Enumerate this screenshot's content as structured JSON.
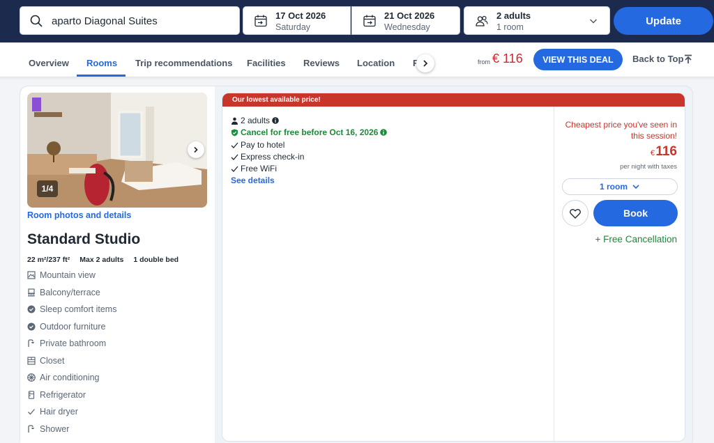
{
  "search": {
    "destination": "aparto Diagonal Suites",
    "checkin_date": "17 Oct 2026",
    "checkin_day": "Saturday",
    "checkout_date": "21 Oct 2026",
    "checkout_day": "Wednesday",
    "guests": "2 adults",
    "rooms": "1 room",
    "update_label": "Update"
  },
  "nav": {
    "tabs": [
      {
        "label": "Overview"
      },
      {
        "label": "Rooms"
      },
      {
        "label": "Trip recommendations"
      },
      {
        "label": "Facilities"
      },
      {
        "label": "Reviews"
      },
      {
        "label": "Location"
      }
    ],
    "truncated_tab": "F",
    "from_label": "from",
    "from_price": "€ 116",
    "deal_label": "VIEW THIS DEAL",
    "back_to_top": "Back to Top"
  },
  "room": {
    "photo_count": "1/4",
    "photo_link": "Room photos and details",
    "title": "Standard Studio",
    "size": "22 m²/237 ft²",
    "max_guests": "Max 2 adults",
    "bed": "1 double bed",
    "amenities": [
      {
        "label": "Mountain view",
        "icon": "mountain-view-icon"
      },
      {
        "label": "Balcony/terrace",
        "icon": "balcony-icon"
      },
      {
        "label": "Sleep comfort items",
        "icon": "check-circle-icon"
      },
      {
        "label": "Outdoor furniture",
        "icon": "check-circle-icon"
      },
      {
        "label": "Private bathroom",
        "icon": "shower-icon"
      },
      {
        "label": "Closet",
        "icon": "closet-icon"
      },
      {
        "label": "Air conditioning",
        "icon": "snowflake-icon"
      },
      {
        "label": "Refrigerator",
        "icon": "refrigerator-icon"
      },
      {
        "label": "Hair dryer",
        "icon": "checkmark-icon"
      },
      {
        "label": "Shower",
        "icon": "shower-icon"
      }
    ]
  },
  "offer": {
    "banner": "Our lowest available price!",
    "adults": "2 adults",
    "cancel": "Cancel for free before Oct 16, 2026",
    "features": [
      "Pay to hotel",
      "Express check-in",
      "Free WiFi"
    ],
    "see_details": "See details",
    "cheapest_note": "Cheapest price you've seen in this session!",
    "currency": "€",
    "price": "116",
    "per_night": "per night with taxes",
    "room_select": "1 room",
    "book_label": "Book",
    "free_cancellation": "+ Free Cancellation"
  },
  "colors": {
    "header_bg": "#1c2a4d",
    "accent": "#2469e0",
    "price_red": "#d0282e",
    "banner_red": "#c8352b",
    "green": "#1c8a3a"
  }
}
